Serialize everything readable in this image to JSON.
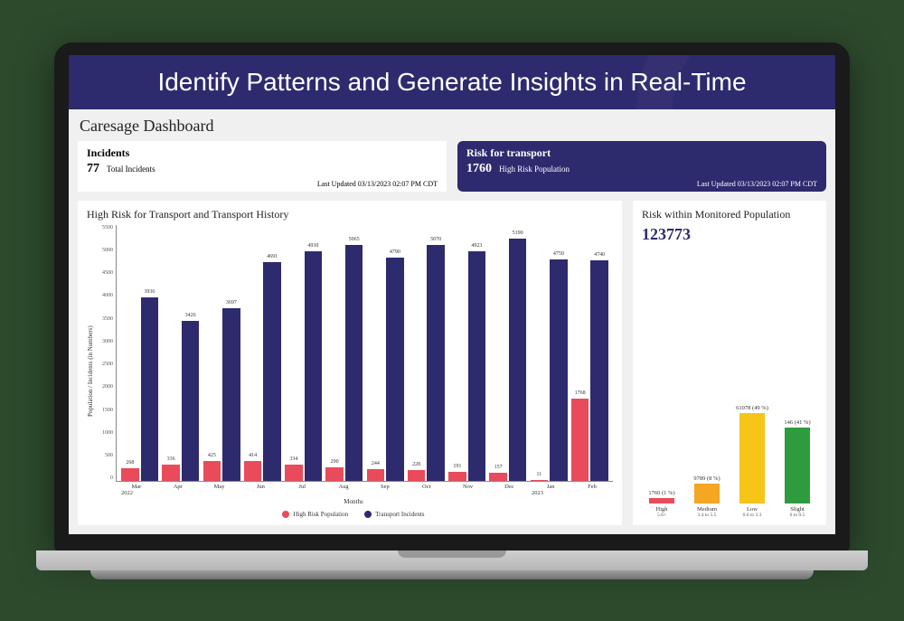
{
  "banner": {
    "title": "Identify Patterns and Generate Insights in Real-Time"
  },
  "dashboard_title": "Caresage Dashboard",
  "cards": {
    "incidents": {
      "title": "Incidents",
      "value": "77",
      "sub": "Total Incidents",
      "updated": "Last Updated 03/13/2023 02:07 PM CDT"
    },
    "risk_transport": {
      "title": "Risk for transport",
      "value": "1760",
      "sub": "High Risk Population",
      "updated": "Last Updated 03/13/2023 02:07 PM CDT"
    }
  },
  "chart_data": {
    "type": "bar",
    "title": "High Risk for Transport and Transport History",
    "xlabel": "Months",
    "ylabel": "Population / Incidents (in Numbers)",
    "ylim": [
      0,
      5500
    ],
    "yticks": [
      "5500",
      "5000",
      "4500",
      "4000",
      "3500",
      "3000",
      "2500",
      "2000",
      "1500",
      "1000",
      "500",
      "0"
    ],
    "categories": [
      "Mar",
      "Apr",
      "May",
      "Jun",
      "Jul",
      "Aug",
      "Sep",
      "Oct",
      "Nov",
      "Dec",
      "Jan",
      "Feb"
    ],
    "year_labels": {
      "y2022": "2022",
      "y2023": "2023"
    },
    "series": [
      {
        "name": "High Risk Population",
        "values": [
          268,
          336,
          425,
          414,
          334,
          290,
          244,
          228,
          191,
          157,
          11,
          1768
        ],
        "color": "#e94b5b"
      },
      {
        "name": "Transport Incidents",
        "values": [
          3936,
          3426,
          3697,
          4691,
          4930,
          5065,
          4790,
          5070,
          4923,
          5190,
          4759,
          4740
        ],
        "color": "#2e2a6e"
      }
    ],
    "legend": {
      "pos": "bottom"
    }
  },
  "risk_panel": {
    "title": "Risk within Monitored Population",
    "total": "123773",
    "bars": [
      {
        "label": "High",
        "range": "5.6+",
        "value": 1760,
        "pct": "1 %",
        "color": "high"
      },
      {
        "label": "Medium",
        "range": "3.4 to 5.5",
        "value": 9789,
        "pct": "8 %",
        "color": "med"
      },
      {
        "label": "Low",
        "range": "0.6 to 3.3",
        "value": 61078,
        "pct": "49 %",
        "color": "low"
      },
      {
        "label": "Slight",
        "range": "0 to 0.5",
        "value": 146,
        "pct": "41 %",
        "color": "slight"
      }
    ]
  }
}
